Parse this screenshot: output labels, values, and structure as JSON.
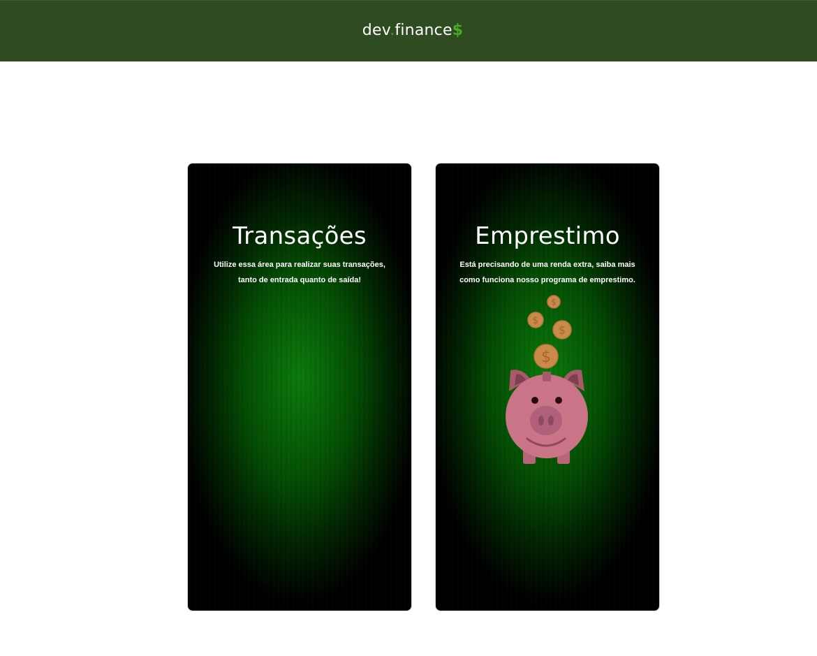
{
  "header": {
    "logo": {
      "part1": "dev",
      "dot": ".",
      "part2": "finance",
      "symbol": "$"
    }
  },
  "cards": [
    {
      "title": "Transações",
      "description": "Utilize essa área para realizar suas transações, tanto de entrada quanto de saída!"
    },
    {
      "title": "Emprestimo",
      "description": "Está precisando de uma renda extra, saiba mais como funciona nosso programa de emprestimo.",
      "illustration": "piggy-bank-with-coins"
    }
  ],
  "colors": {
    "header_bg": "#2f4b22",
    "accent": "#49aa26",
    "card_glow": "#0b7a0b",
    "piggy_pink": "#c97587",
    "coin_gold": "#c98a4a"
  }
}
